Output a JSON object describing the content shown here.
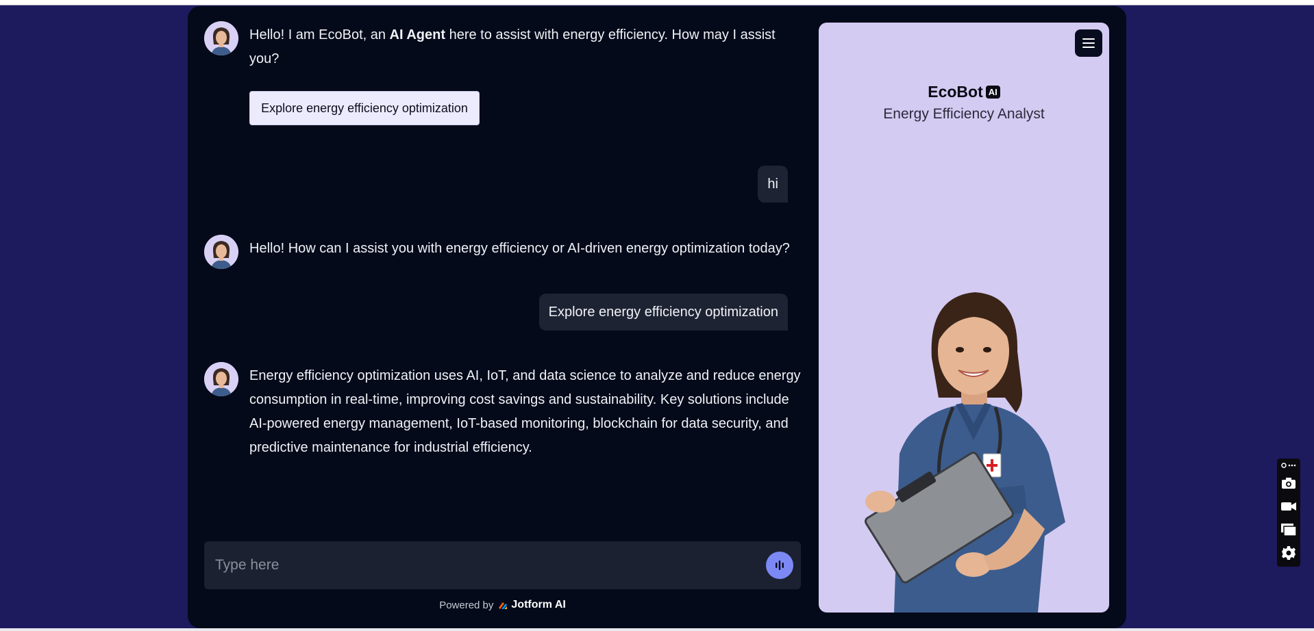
{
  "chat": {
    "messages": [
      {
        "role": "bot",
        "pre": "Hello! I am EcoBot, an ",
        "bold": "AI Agent",
        "post": " here to assist with energy efficiency. How may I assist you?"
      },
      {
        "role": "user",
        "text": "hi"
      },
      {
        "role": "bot",
        "text": "Hello! How can I assist you with energy efficiency or AI-driven energy optimization today?"
      },
      {
        "role": "user",
        "text": "Explore energy efficiency optimization"
      },
      {
        "role": "bot",
        "text": "Energy efficiency optimization uses AI, IoT, and data science to analyze and reduce energy consumption in real-time, improving cost savings and sustainability. Key solutions include AI-powered energy management, IoT-based monitoring, blockchain for data security, and predictive maintenance for industrial efficiency."
      }
    ],
    "suggestion": "Explore energy efficiency optimization",
    "input_placeholder": "Type here"
  },
  "footer": {
    "powered_by": "Powered by",
    "brand": "Jotform AI"
  },
  "agent": {
    "name": "EcoBot",
    "badge": "AI",
    "role": "Energy Efficiency Analyst"
  },
  "colors": {
    "page_bg": "#1e1a5e",
    "app_bg": "#040a1a",
    "panel_bg": "#d4cbf2",
    "accent": "#7c89f5",
    "user_bubble": "#1e2333"
  },
  "icons": [
    "menu-icon",
    "microphone-icon",
    "jotform-logo-icon",
    "camera-icon",
    "video-icon",
    "windows-icon",
    "gear-icon",
    "extension-icon"
  ]
}
